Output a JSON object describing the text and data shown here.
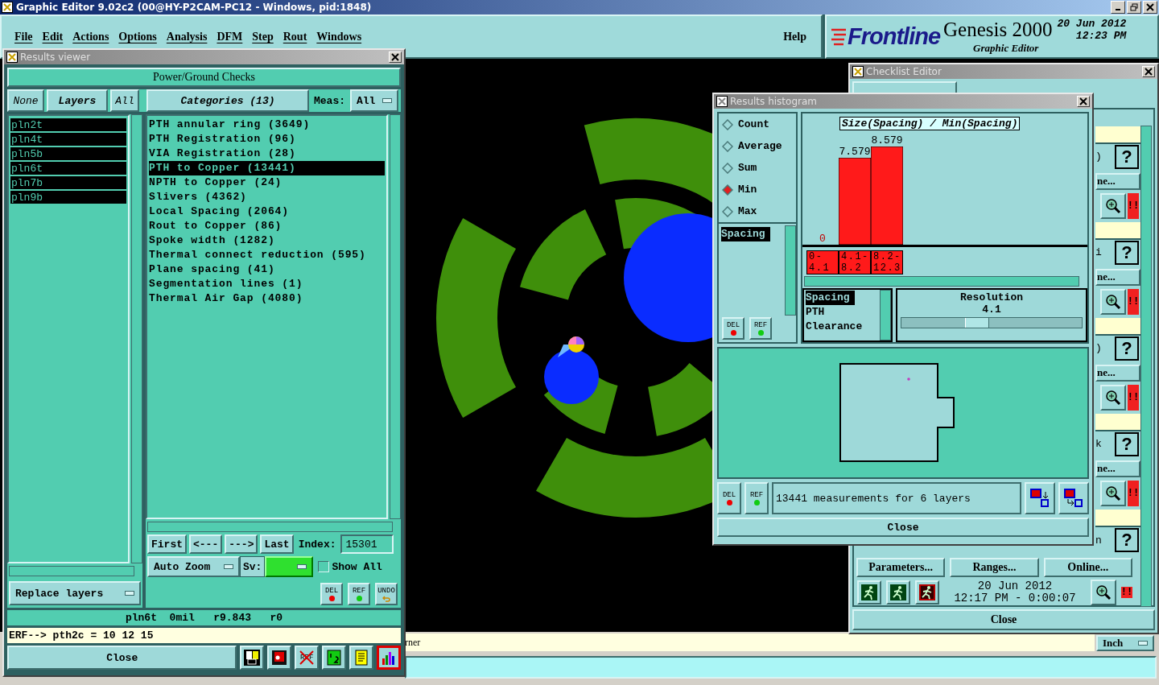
{
  "app": {
    "title": "Graphic Editor 9.02c2 (00@HY-P2CAM-PC12 - Windows, pid:1848)"
  },
  "menu": [
    "File",
    "Edit",
    "Actions",
    "Options",
    "Analysis",
    "DFM",
    "Step",
    "Rout",
    "Windows"
  ],
  "help_menu": "Help",
  "brand": {
    "logo": "Frontline",
    "product": "Genesis 2000",
    "subtitle": "Graphic Editor",
    "date": "20 Jun 2012",
    "time": "12:23 PM"
  },
  "results_viewer": {
    "title": "Results viewer",
    "header": "Power/Ground Checks",
    "layer_buttons": [
      "None",
      "Layers",
      "All"
    ],
    "categories_button": "Categories (13)",
    "meas_label": "Meas:",
    "meas_value": "All",
    "layers": [
      {
        "name": "pln2t",
        "selected": true
      },
      {
        "name": "pln4t",
        "selected": true
      },
      {
        "name": "pln5b",
        "selected": true
      },
      {
        "name": "pln6t",
        "selected": true
      },
      {
        "name": "pln7b",
        "selected": true
      },
      {
        "name": "pln9b",
        "selected": true
      }
    ],
    "categories": [
      {
        "label": "PTH annular ring (3649)",
        "selected": false
      },
      {
        "label": "PTH Registration (96)",
        "selected": false
      },
      {
        "label": "VIA Registration (28)",
        "selected": false
      },
      {
        "label": "PTH to Copper (13441)",
        "selected": true
      },
      {
        "label": "NPTH to Copper (24)",
        "selected": false
      },
      {
        "label": "Slivers (4362)",
        "selected": false
      },
      {
        "label": "Local Spacing (2064)",
        "selected": false
      },
      {
        "label": "Rout to Copper (86)",
        "selected": false
      },
      {
        "label": "Spoke width (1282)",
        "selected": false
      },
      {
        "label": "Thermal connect reduction (595)",
        "selected": false
      },
      {
        "label": "Plane spacing (41)",
        "selected": false
      },
      {
        "label": "Segmentation lines (1)",
        "selected": false
      },
      {
        "label": "Thermal Air Gap (4080)",
        "selected": false
      }
    ],
    "nav_buttons": [
      "First",
      "<---",
      "--->",
      "Last"
    ],
    "index_label": "Index:",
    "index_value": "15301",
    "zoom_menu": "Auto Zoom",
    "sv_label": "Sv:",
    "show_all": {
      "label": "Show All",
      "checked": false
    },
    "replace_menu": "Replace layers",
    "edit_buttons": [
      "DEL",
      "REF",
      "UNDO"
    ],
    "status": "pln6t  0mil   r9.843   r0",
    "erf_line": "ERF--> pth2c = 10 12 15",
    "close": "Close",
    "tools": [
      {
        "kind": "layers",
        "selected": false
      },
      {
        "kind": "stop",
        "selected": false
      },
      {
        "kind": "ref-off",
        "label": "REF",
        "selected": false
      },
      {
        "kind": "half",
        "selected": false
      },
      {
        "kind": "notes",
        "selected": false
      },
      {
        "kind": "histogram",
        "selected": true
      }
    ]
  },
  "canvas_status": "rner",
  "units_menu": "Inch",
  "checklist_editor": {
    "title": "Checklist Editor",
    "rows": [
      {
        "tail": ")",
        "help": "?",
        "run_button": "ne...",
        "flag": "!!"
      },
      {
        "tail": "i",
        "help": "?",
        "run_button": "ne...",
        "flag": "!!"
      },
      {
        "tail": ")",
        "help": "?",
        "run_button": "ne...",
        "flag": "!!"
      },
      {
        "tail": "k",
        "help": "?",
        "run_button": "ne...",
        "flag": "!!"
      }
    ],
    "last_tail": "n",
    "last_help": "?",
    "run_flag": "!!",
    "buttons": [
      "Parameters...",
      "Ranges...",
      "Online..."
    ],
    "run_date": "20 Jun 2012",
    "run_time": "12:17 PM - 0:00:07",
    "close": "Close"
  },
  "histogram": {
    "title": "Results histogram",
    "stats": [
      {
        "label": "Count",
        "selected": false
      },
      {
        "label": "Average",
        "selected": false
      },
      {
        "label": "Sum",
        "selected": false
      },
      {
        "label": "Min",
        "selected": true
      },
      {
        "label": "Max",
        "selected": false
      }
    ],
    "measures": [
      {
        "label": "Spacing",
        "selected": true
      }
    ],
    "chart_data": {
      "type": "bar",
      "title": "Size(Spacing) / Min(Spacing)",
      "categories": [
        "0-4.1",
        "4.1-8.2",
        "8.2-12.3"
      ],
      "values": [
        0,
        7.579,
        8.579
      ],
      "data_labels": true
    },
    "types": [
      {
        "label": "Spacing",
        "selected": true
      },
      {
        "label": "PTH",
        "selected": false
      },
      {
        "label": "Clearance",
        "selected": false
      }
    ],
    "resolution_label": "Resolution",
    "resolution_value": "4.1",
    "resolution": {
      "level": 0.42
    },
    "side_buttons": [
      "DEL",
      "REF"
    ],
    "bottom_buttons": [
      "DEL",
      "REF"
    ],
    "summary": "13441 measurements for 6 layers",
    "close": "Close"
  }
}
